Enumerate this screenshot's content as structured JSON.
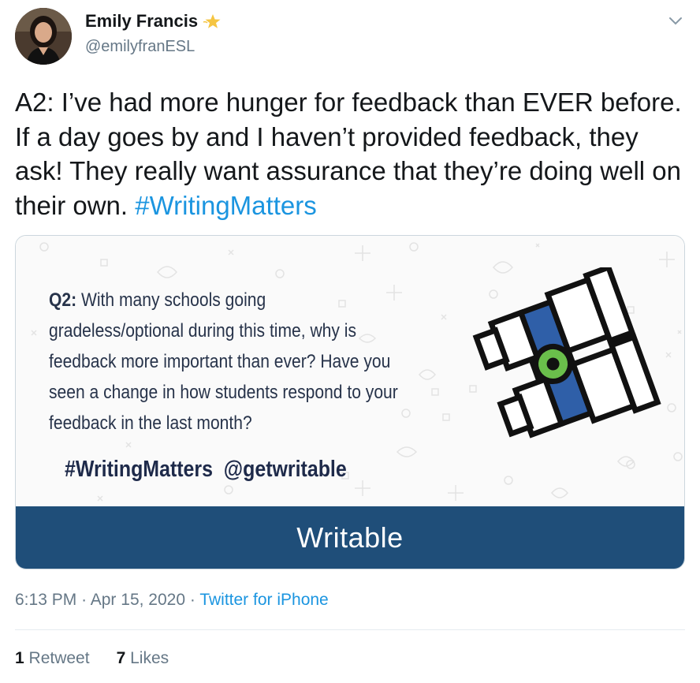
{
  "author": {
    "name": "Emily Francis",
    "handle": "@emilyfranESL"
  },
  "tweet": {
    "text": "A2: I’ve had more hunger for feedback than EVER before. If a day goes by and I haven’t provided feedback, they ask! They really want assurance that they’re doing well on their own.",
    "hashtag": "#WritingMatters"
  },
  "card": {
    "question_label": "Q2:",
    "question_text": "With many schools going gradeless/optional during this time, why is feedback more important than ever? Have you seen a change in how students respond to your feedback  in the last month?",
    "hashtag": "#WritingMatters",
    "mention": "@getwritable",
    "brand": "Writable",
    "colors": {
      "bar": "#1f4e79",
      "accent_blue": "#2f5fa8",
      "accent_green": "#6abf4b"
    }
  },
  "meta": {
    "time": "6:13 PM",
    "date": "Apr 15, 2020",
    "separator": "·",
    "source": "Twitter for iPhone"
  },
  "stats": {
    "retweets_count": "1",
    "retweets_label": "Retweet",
    "likes_count": "7",
    "likes_label": "Likes"
  },
  "icons": [
    "star-emoji-icon",
    "chevron-down-icon",
    "binoculars-icon"
  ]
}
